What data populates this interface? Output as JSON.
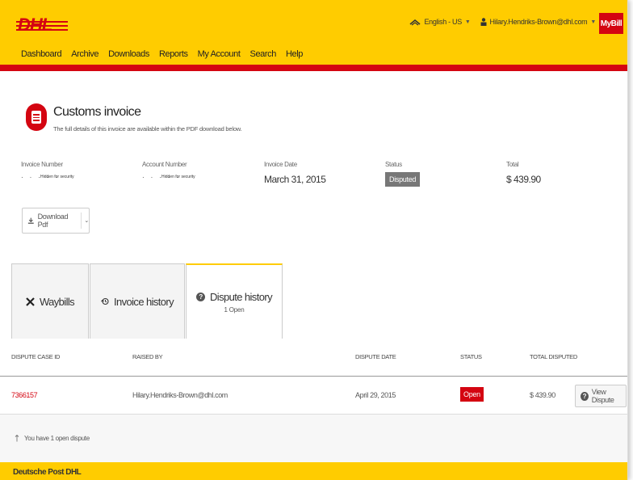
{
  "header": {
    "logo_text": "DHL",
    "language": "English - US",
    "user_email": "Hilary.Hendriks-Brown@dhl.com",
    "app_badge": "MyBill",
    "nav": [
      "Dashboard",
      "Archive",
      "Downloads",
      "Reports",
      "My Account",
      "Search",
      "Help"
    ]
  },
  "invoice": {
    "title": "Customs invoice",
    "subtitle": "The full details of this invoice are available within the PDF download below.",
    "fields": {
      "invoice_number_label": "Invoice Number",
      "invoice_number_hint": "Hidden for security",
      "account_number_label": "Account Number",
      "account_number_hint": "Hidden for security",
      "invoice_date_label": "Invoice Date",
      "invoice_date": "March 31, 2015",
      "status_label": "Status",
      "status": "Disputed",
      "total_label": "Total",
      "total": "$ 439.90"
    },
    "download_label": "Download Pdf"
  },
  "tabs": [
    {
      "label": "Waybills",
      "sub": ""
    },
    {
      "label": "Invoice history",
      "sub": ""
    },
    {
      "label": "Dispute history",
      "sub": "1 Open"
    }
  ],
  "table": {
    "columns": [
      "DISPUTE CASE ID",
      "RAISED BY",
      "DISPUTE DATE",
      "STATUS",
      "TOTAL DISPUTED"
    ],
    "rows": [
      {
        "case_id": "7366157",
        "raised_by": "Hilary.Hendriks-Brown@dhl.com",
        "date": "April 29, 2015",
        "status": "Open",
        "total": "$ 439.90",
        "action": "View Dispute"
      }
    ]
  },
  "footer_note": "You have 1 open dispute",
  "footer_brand": "Deutsche Post DHL",
  "colors": {
    "yellow": "#ffcc00",
    "red": "#d40511",
    "grey_badge": "#777777"
  }
}
